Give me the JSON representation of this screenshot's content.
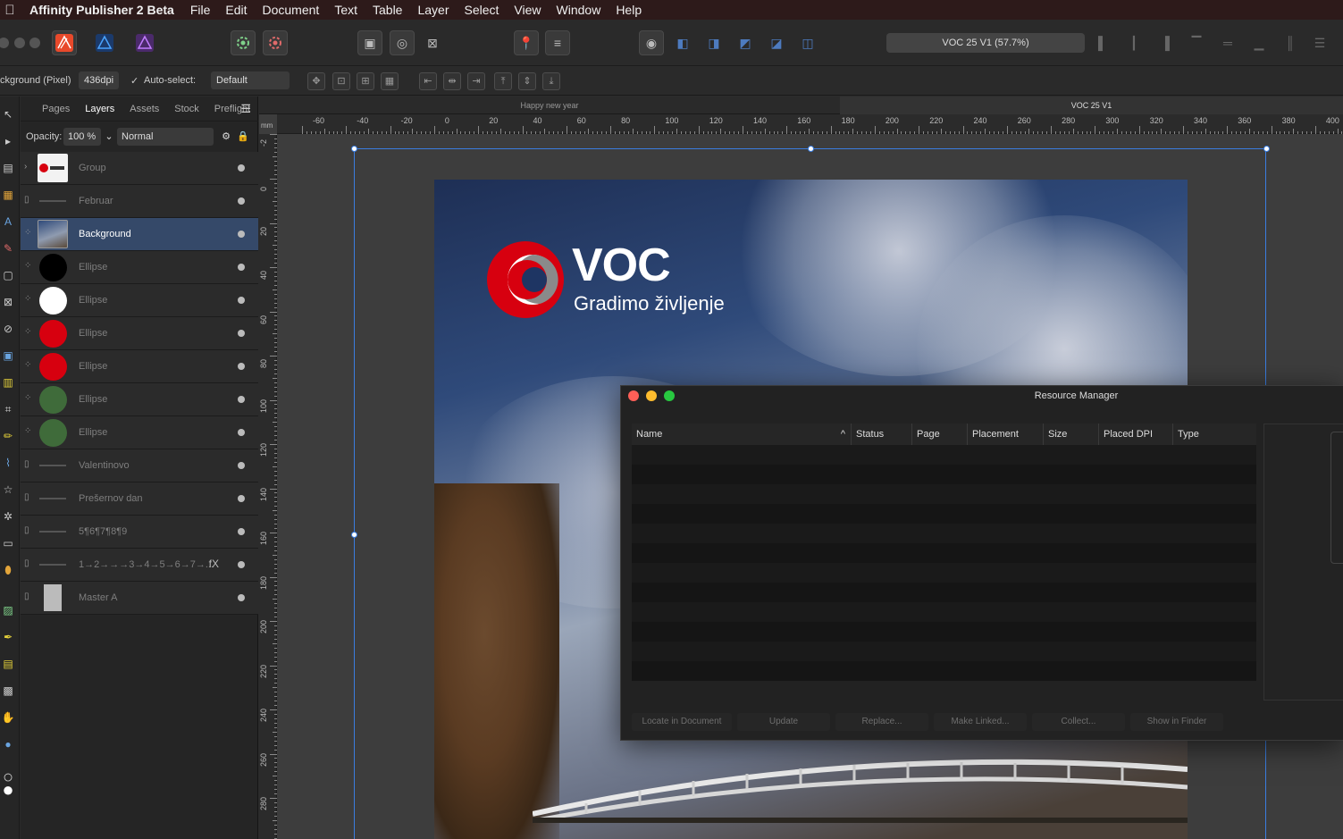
{
  "menubar": {
    "app_name": "Affinity Publisher 2 Beta",
    "items": [
      "File",
      "Edit",
      "Document",
      "Text",
      "Table",
      "Layer",
      "Select",
      "View",
      "Window",
      "Help"
    ]
  },
  "toolbar": {
    "zoom_label": "VOC 25 V1 (57.7%)"
  },
  "context": {
    "layer_info": "ckground (Pixel)",
    "dpi": "436dpi",
    "auto_select_label": "Auto-select:",
    "auto_select_value": "Default"
  },
  "panel": {
    "tabs": [
      "Pages",
      "Layers",
      "Assets",
      "Stock",
      "Preflight"
    ],
    "active_tab": "Layers",
    "opacity_label": "Opacity:",
    "opacity_value": "100 %",
    "blend_mode": "Normal",
    "layers": [
      {
        "name": "Group",
        "thumb": "voc"
      },
      {
        "name": "Februar",
        "thumb": "text"
      },
      {
        "name": "Background",
        "thumb": "photo",
        "selected": true
      },
      {
        "name": "Ellipse",
        "thumb": "circle",
        "color": "#000000"
      },
      {
        "name": "Ellipse",
        "thumb": "circle",
        "color": "#ffffff"
      },
      {
        "name": "Ellipse",
        "thumb": "circle",
        "color": "#d7000f"
      },
      {
        "name": "Ellipse",
        "thumb": "circle",
        "color": "#d7000f"
      },
      {
        "name": "Ellipse",
        "thumb": "circle",
        "color": "#3f6b3a"
      },
      {
        "name": "Ellipse",
        "thumb": "circle",
        "color": "#3f6b3a"
      },
      {
        "name": "Valentinovo",
        "thumb": "text"
      },
      {
        "name": "Prešernov dan",
        "thumb": "text"
      },
      {
        "name": "5¶6¶7¶8¶9",
        "thumb": "text"
      },
      {
        "name": "1→2→→→3→4→5→6→7→...",
        "thumb": "text",
        "fx": "fX"
      },
      {
        "name": "Master A",
        "thumb": "master"
      }
    ]
  },
  "document": {
    "tabs": [
      "Happy new year",
      "VOC 25 V1"
    ],
    "ruler_unit": "mm",
    "h_ruler": [
      "-60",
      "-40",
      "-20",
      "0",
      "20",
      "40",
      "60",
      "80",
      "100",
      "120",
      "140",
      "160",
      "180",
      "200",
      "220",
      "240",
      "260",
      "280",
      "300",
      "320",
      "340",
      "360",
      "380",
      "400"
    ],
    "v_ruler": [
      "-2",
      "0",
      "20",
      "40",
      "60",
      "80",
      "100",
      "120",
      "140",
      "160",
      "180",
      "200",
      "220",
      "240",
      "260",
      "280"
    ],
    "logo_wordmark": "VOC",
    "logo_tagline": "Gradimo življenje",
    "logo_red": "#d7000f"
  },
  "resource_manager": {
    "title": "Resource Manager",
    "columns": [
      "Name",
      "Status",
      "Page",
      "Placement",
      "Size",
      "Placed DPI",
      "Type"
    ],
    "buttons": [
      "Locate in Document",
      "Update",
      "Replace...",
      "Make Linked...",
      "Collect...",
      "Show in Finder"
    ]
  }
}
